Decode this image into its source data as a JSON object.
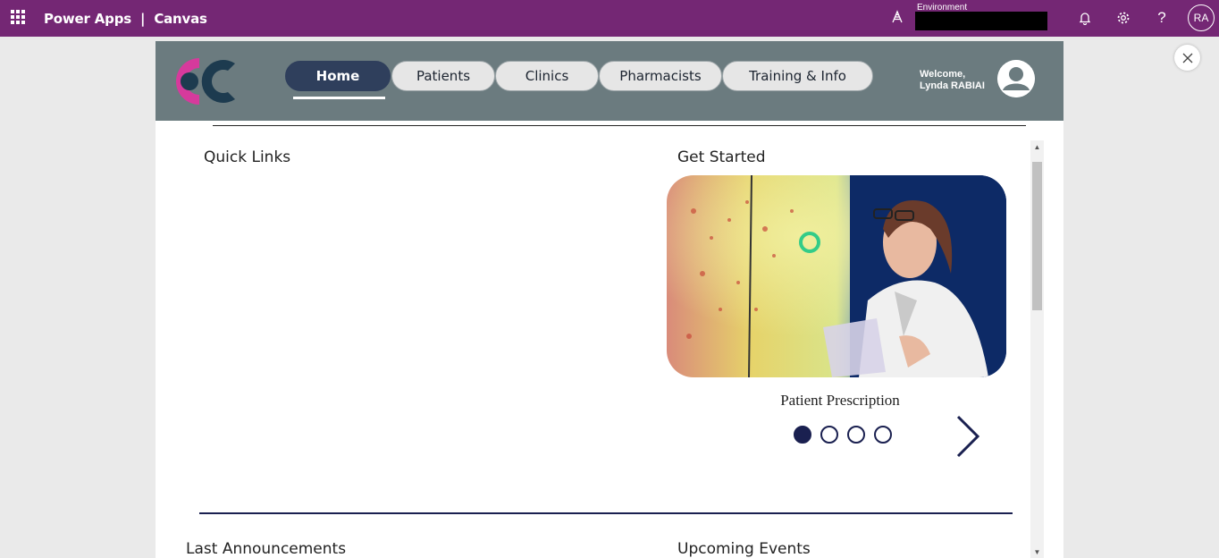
{
  "powerapps_bar": {
    "app_name": "Power Apps",
    "separator": "|",
    "canvas_label": "Canvas",
    "environment_label": "Environment",
    "environment_value": "",
    "icons": [
      "waffle-icon",
      "environment-icon",
      "bell-icon",
      "gear-icon",
      "help-icon"
    ],
    "user_initials": "RA",
    "bar_color": "#742774"
  },
  "app": {
    "header_color": "#6b7b7f",
    "nav": [
      {
        "label": "Home",
        "active": true
      },
      {
        "label": "Patients",
        "active": false
      },
      {
        "label": "Clinics",
        "active": false
      },
      {
        "label": "Pharmacists",
        "active": false
      },
      {
        "label": "Training & Info",
        "active": false
      }
    ],
    "welcome_line1": "Welcome,",
    "welcome_line2": "Lynda RABIAI",
    "quick_links_title": "Quick Links",
    "get_started_title": "Get Started",
    "carousel": {
      "caption": "Patient Prescription",
      "dots": 4,
      "active_dot": 1,
      "image": "scientist-at-data-screen"
    },
    "last_announcements_title": "Last Announcements",
    "upcoming_events_title": "Upcoming Events",
    "accent_color": "#1a2050",
    "active_nav_color": "#2f3f5c"
  }
}
